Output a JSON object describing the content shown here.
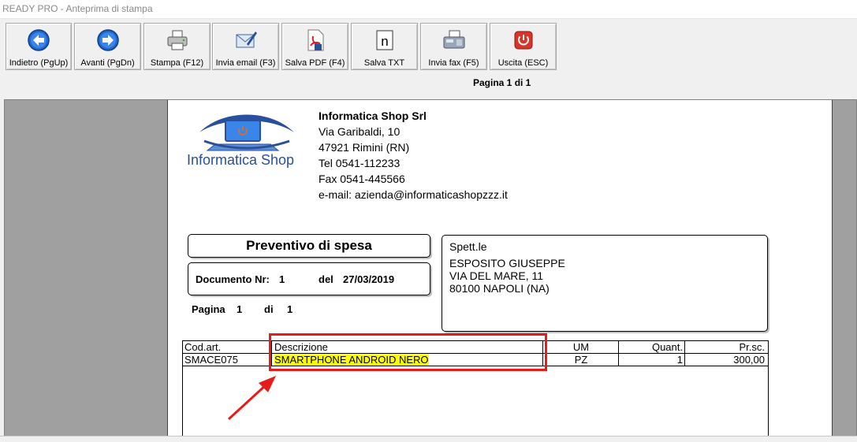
{
  "window": {
    "title": "READY PRO - Anteprima di stampa"
  },
  "toolbar": {
    "buttons": [
      {
        "label": "Indietro (PgUp)",
        "icon": "arrow-left-icon"
      },
      {
        "label": "Avanti (PgDn)",
        "icon": "arrow-right-icon"
      },
      {
        "label": "Stampa (F12)",
        "icon": "printer-icon"
      },
      {
        "label": "Invia email (F3)",
        "icon": "email-icon"
      },
      {
        "label": "Salva PDF (F4)",
        "icon": "pdf-icon"
      },
      {
        "label": "Salva TXT",
        "icon": "txt-icon",
        "glyph": "n"
      },
      {
        "label": "Invia fax (F5)",
        "icon": "fax-icon"
      },
      {
        "label": "Uscita (ESC)",
        "icon": "exit-icon"
      }
    ],
    "page_counter": "Pagina 1 di 1"
  },
  "document": {
    "logo_text": "Informatica Shop",
    "company": {
      "name": "Informatica Shop Srl",
      "address": "Via Garibaldi, 10",
      "city": "47921 Rimini (RN)",
      "tel": "Tel 0541-112233",
      "fax": "Fax 0541-445566",
      "email": "e-mail: azienda@informaticashopzzz.it"
    },
    "title": "Preventivo di spesa",
    "number_label": "Documento Nr:",
    "number": "1",
    "date_label": "del",
    "date": "27/03/2019",
    "page_label": "Pagina",
    "page_number": "1",
    "page_of_label": "di",
    "page_total": "1",
    "recipient": {
      "label": "Spett.le",
      "name": "ESPOSITO GIUSEPPE",
      "address": "VIA DEL MARE, 11",
      "city": "80100 NAPOLI (NA)"
    },
    "table": {
      "headers": [
        "Cod.art.",
        "Descrizione",
        "UM",
        "Quant.",
        "Pr.sc."
      ],
      "rows": [
        [
          "SMACE075",
          "SMARTPHONE ANDROID NERO",
          "PZ",
          "1",
          "300,00"
        ]
      ]
    }
  },
  "colors": {
    "highlight": "#ffff00",
    "annotation": "#e81b1b",
    "logo_blue": "#2a4f9c"
  }
}
